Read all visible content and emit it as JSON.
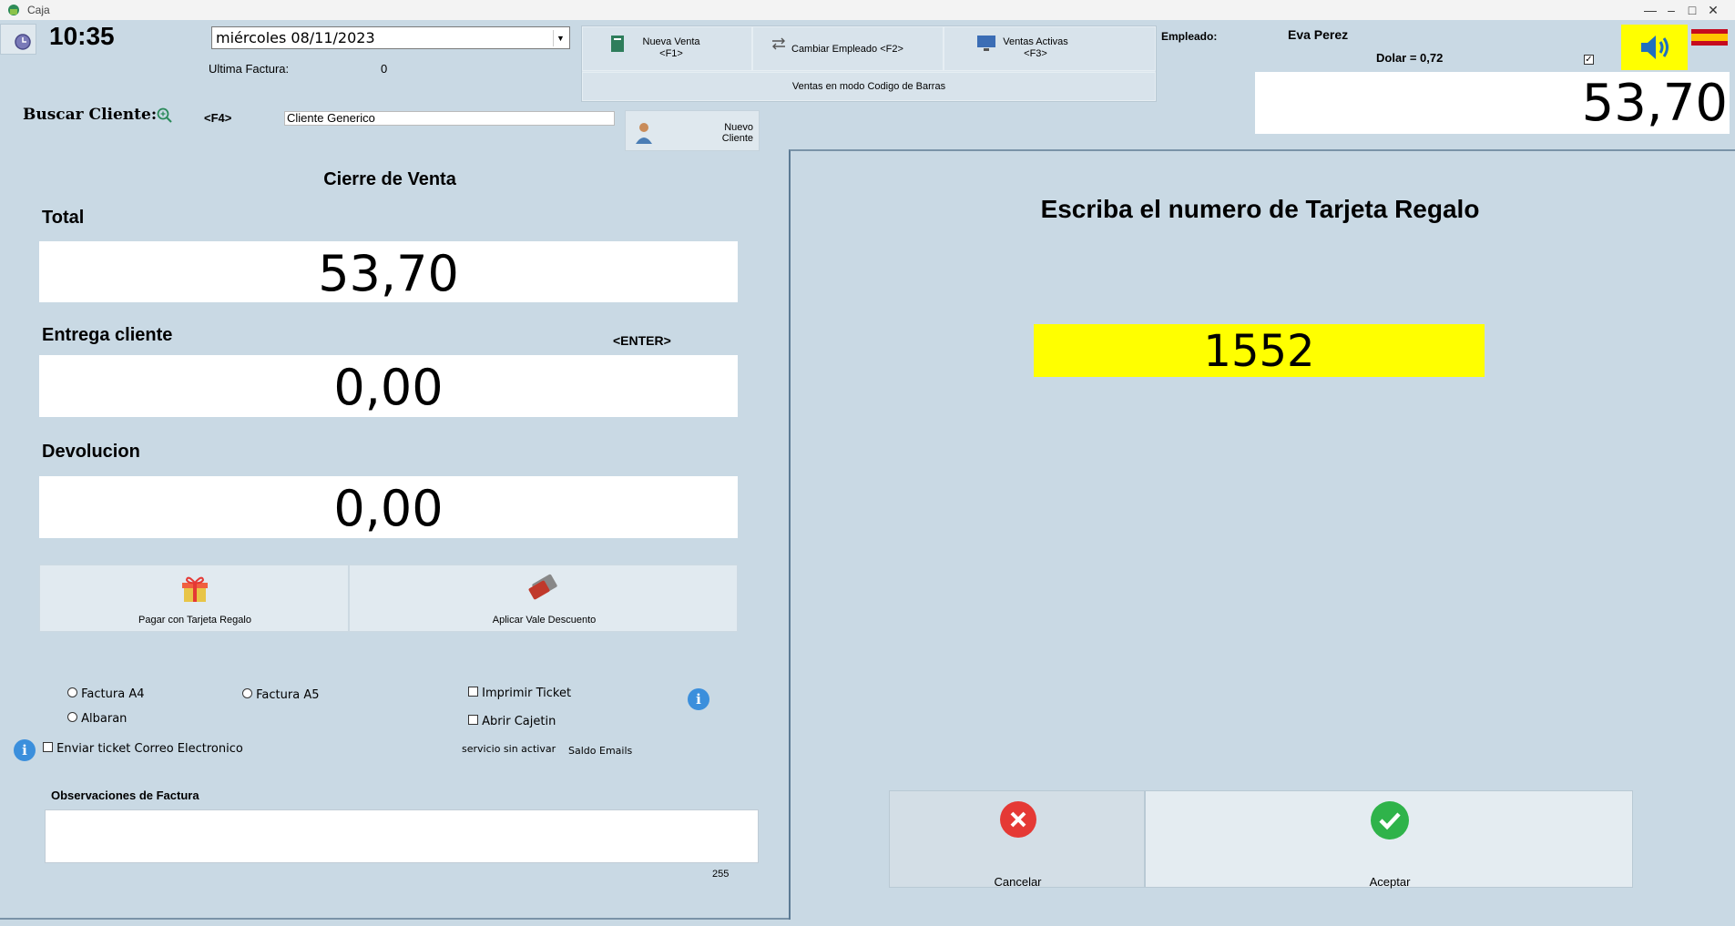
{
  "window": {
    "title": "Caja"
  },
  "header": {
    "time": "10:35",
    "date_value": "miércoles 08/11/2023",
    "ultima_factura_label": "Ultima Factura:",
    "ultima_factura_value": "0",
    "empleado_label": "Empleado:",
    "empleado_value": "Eva Perez",
    "dolar_label": "Dolar = 0,72",
    "total_display": "53,70"
  },
  "toolbar": {
    "nueva_venta": "Nueva Venta",
    "nueva_venta_key": "<F1>",
    "cambiar_empleado": "Cambiar Empleado <F2>",
    "ventas_activas": "Ventas Activas",
    "ventas_activas_key": "<F3>",
    "modo_codigo": "Ventas en modo Codigo de Barras"
  },
  "cliente": {
    "buscar_label": "Buscar Cliente:",
    "key_hint": "<F4>",
    "value": "Cliente Generico",
    "nuevo_line1": "Nuevo",
    "nuevo_line2": "Cliente"
  },
  "cierre": {
    "title": "Cierre de Venta",
    "total_label": "Total",
    "total_value": "53,70",
    "entrega_label": "Entrega cliente",
    "enter_hint": "<ENTER>",
    "entrega_value": "0,00",
    "devolucion_label": "Devolucion",
    "devolucion_value": "0,00",
    "pagar_tarjeta": "Pagar con Tarjeta Regalo",
    "aplicar_vale": "Aplicar Vale Descuento"
  },
  "options": {
    "factura_a4": "Factura A4",
    "factura_a5": "Factura A5",
    "albaran": "Albaran",
    "imprimir_ticket": "Imprimir Ticket",
    "abrir_cajetin": "Abrir Cajetin",
    "enviar_ticket": "Enviar ticket Correo Electronico",
    "servicio": "servicio sin activar",
    "saldo": "Saldo Emails",
    "observaciones_label": "Observaciones de Factura",
    "observaciones_count": "255"
  },
  "tarjeta": {
    "prompt": "Escriba el numero de Tarjeta Regalo",
    "value": "1552",
    "cancelar": "Cancelar",
    "aceptar": "Aceptar"
  },
  "colors": {
    "highlight": "#ffff00",
    "accent_red": "#e53935",
    "accent_green": "#2fb34a"
  }
}
